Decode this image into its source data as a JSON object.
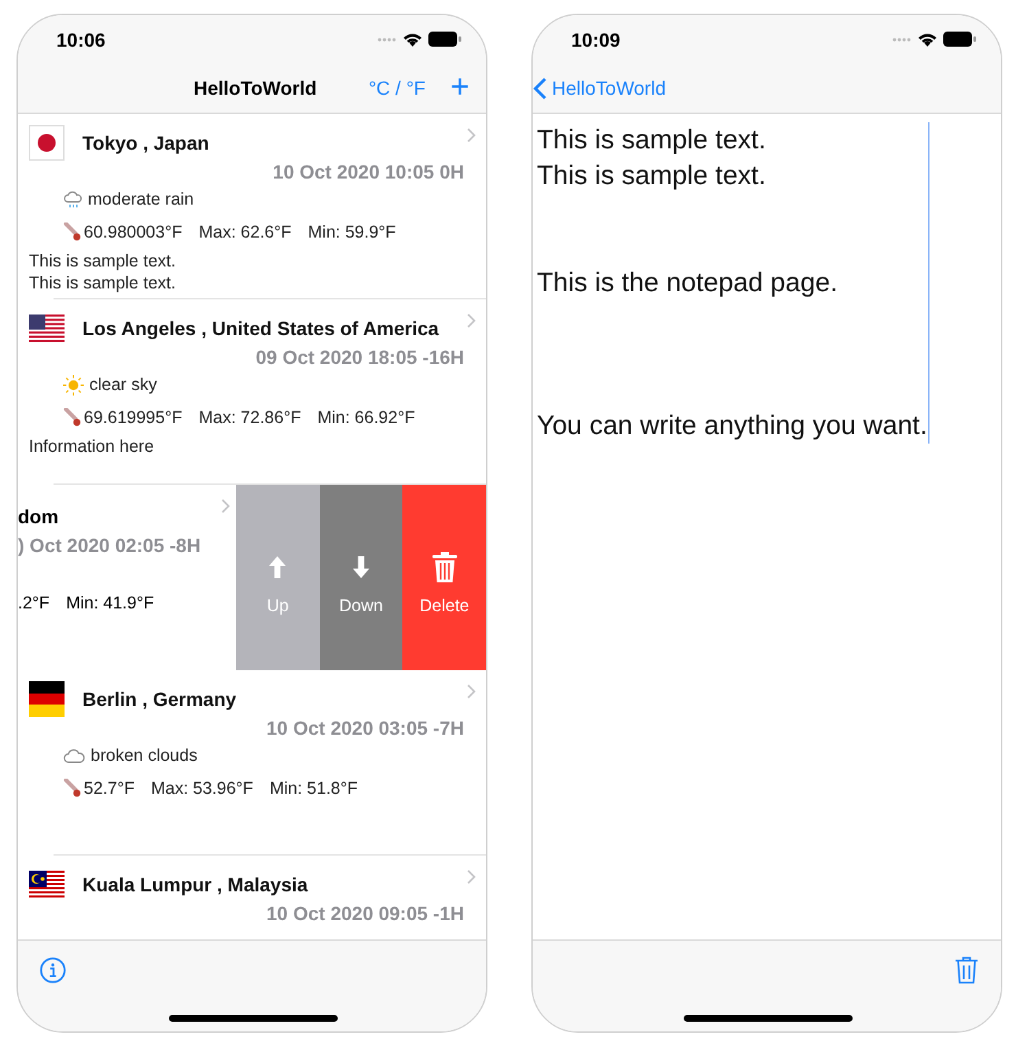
{
  "list_screen": {
    "status_bar": {
      "time": "10:06"
    },
    "nav_bar": {
      "title": "HelloToWorld",
      "unit_toggle": "°C / °F",
      "add_button": "+"
    },
    "rows": [
      {
        "title": "Tokyo , Japan",
        "datetime": "10 Oct 2020 10:05 0H",
        "weather": "moderate rain",
        "temp": "60.980003°F",
        "max": "Max: 62.6°F",
        "min": "Min: 59.9°F",
        "notes": [
          "This is sample text.",
          "This is sample text."
        ],
        "swiped": false
      },
      {
        "title": "Los Angeles , United States of America",
        "datetime": "09 Oct 2020 18:05 -16H",
        "weather": "clear sky",
        "temp": "69.619995°F",
        "max": "Max: 72.86°F",
        "min": "Min: 66.92°F",
        "notes": [
          "Information here"
        ],
        "swiped": false
      },
      {
        "title": "dom",
        "datetime": ") Oct 2020 02:05 -8H",
        "max": ".2°F",
        "min": "Min: 41.9°F",
        "swiped": true,
        "actions": [
          {
            "kind": "up",
            "label": "Up"
          },
          {
            "kind": "down",
            "label": "Down"
          },
          {
            "kind": "delete",
            "label": "Delete"
          }
        ]
      },
      {
        "title": "Berlin , Germany",
        "datetime": "10 Oct 2020 03:05 -7H",
        "weather": "broken clouds",
        "temp": "52.7°F",
        "max": "Max: 53.96°F",
        "min": "Min: 51.8°F",
        "swiped": false
      },
      {
        "title": "Kuala Lumpur , Malaysia",
        "datetime": "10 Oct 2020 09:05 -1H",
        "swiped": false
      }
    ]
  },
  "notepad_screen": {
    "status_bar": {
      "time": "10:09"
    },
    "nav_bar": {
      "back_button": "HelloToWorld"
    },
    "text": "This is sample text.\nThis is sample text.\n\n\nThis is the notepad page.\n\n\n\nYou can write anything you want."
  }
}
